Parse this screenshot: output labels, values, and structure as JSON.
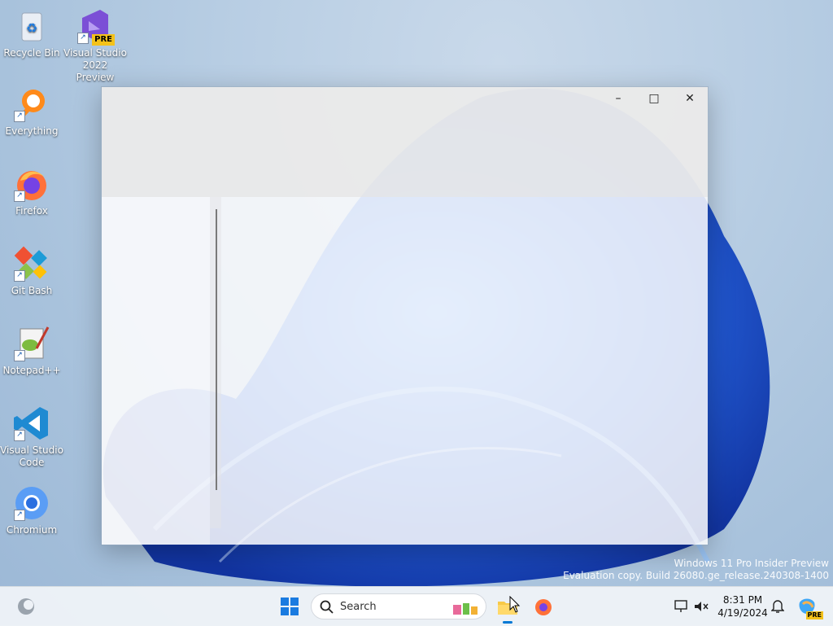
{
  "desktop": {
    "icons": [
      {
        "label": "Recycle Bin",
        "icon": "recycle-bin-icon"
      },
      {
        "label": "Visual Studio 2022 Preview",
        "icon": "visual-studio-icon",
        "badge": "PRE"
      },
      {
        "label": "Everything",
        "icon": "everything-search-icon"
      },
      {
        "label": "Firefox",
        "icon": "firefox-icon"
      },
      {
        "label": "Git Bash",
        "icon": "git-bash-icon"
      },
      {
        "label": "Notepad++",
        "icon": "notepadpp-icon"
      },
      {
        "label": "Visual Studio Code",
        "icon": "vscode-icon"
      },
      {
        "label": "Chromium",
        "icon": "chromium-icon"
      }
    ]
  },
  "window": {
    "controls": {
      "minimize": "–",
      "maximize": "□",
      "close": "✕"
    }
  },
  "watermark": {
    "line1": "Windows 11 Pro Insider Preview",
    "line2": "Evaluation copy. Build 26080.ge_release.240308-1400"
  },
  "taskbar": {
    "search_placeholder": "Search",
    "clock": {
      "time": "8:31 PM",
      "date": "4/19/2024"
    },
    "copilot_badge": "PRE"
  },
  "colors": {
    "accent": "#0078d4",
    "taskbar": "#eef2f7"
  }
}
